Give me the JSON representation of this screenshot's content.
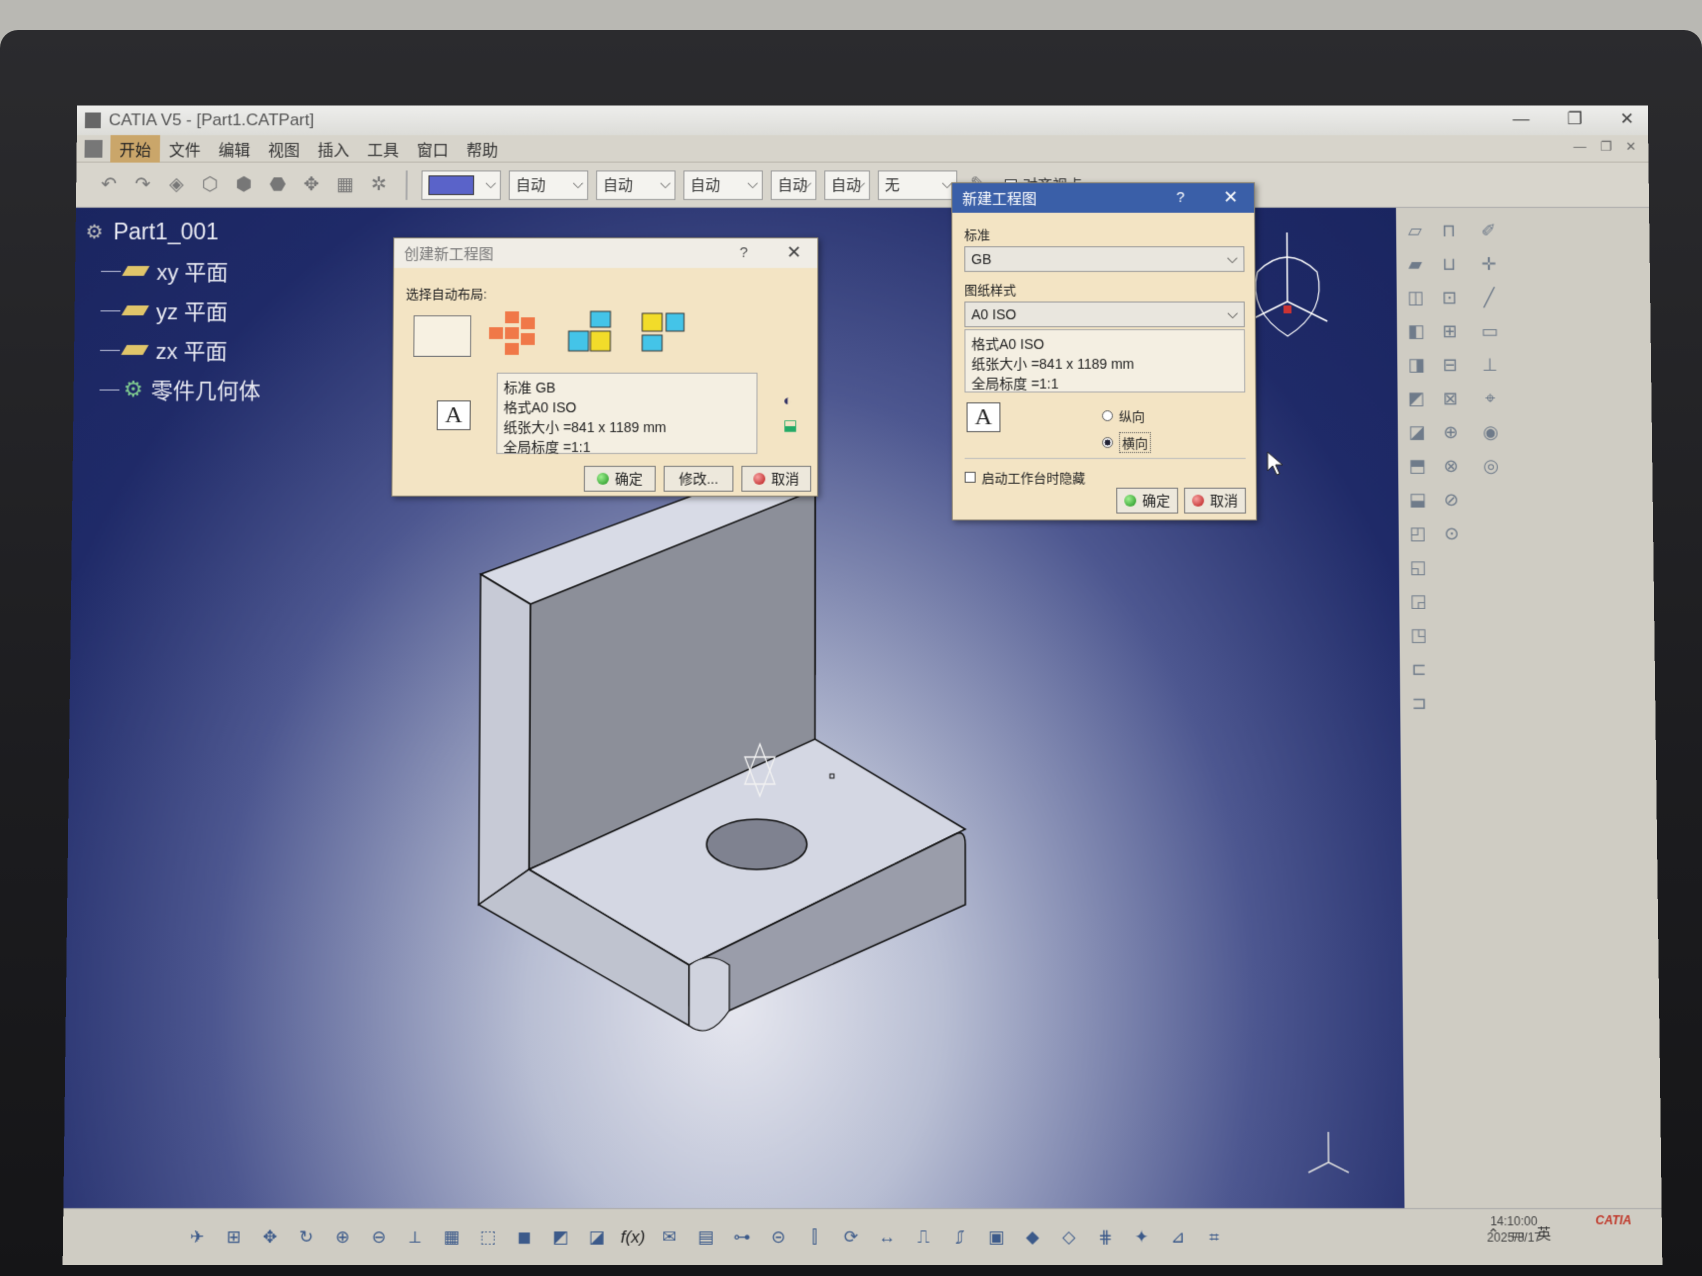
{
  "window": {
    "title": "CATIA V5 - [Part1.CATPart]",
    "min": "—",
    "restore": "❐",
    "close": "✕"
  },
  "menu": {
    "items": [
      {
        "label": "开始",
        "active": true
      },
      {
        "label": "文件"
      },
      {
        "label": "编辑"
      },
      {
        "label": "视图"
      },
      {
        "label": "插入"
      },
      {
        "label": "工具"
      },
      {
        "label": "窗口"
      },
      {
        "label": "帮助"
      }
    ]
  },
  "toolbar": {
    "color": "#5a63c9",
    "combos": [
      "自动",
      "自动",
      "自动",
      "自动",
      "自动",
      "无"
    ],
    "snap_label": "对齐视点"
  },
  "tree": {
    "root": "Part1_001",
    "items": [
      "xy 平面",
      "yz 平面",
      "zx 平面",
      "零件几何体"
    ]
  },
  "dialog_create": {
    "title": "创建新工程图",
    "help": "?",
    "close": "✕",
    "layout_label": "选择自动布局:",
    "info": [
      "标准 GB",
      "格式A0 ISO",
      "纸张大小 =841 x 1189 mm",
      "全局标度 =1:1"
    ],
    "ok": "确定",
    "modify": "修改...",
    "cancel": "取消"
  },
  "dialog_new": {
    "title": "新建工程图",
    "help": "?",
    "close": "✕",
    "standard_label": "标准",
    "standard_value": "GB",
    "sheet_style_label": "图纸样式",
    "sheet_style_value": "A0 ISO",
    "info": [
      "格式A0 ISO",
      "纸张大小 =841 x 1189 mm",
      "全局标度 =1:1"
    ],
    "portrait": "纵向",
    "landscape": "横向",
    "orientation_selected": "landscape",
    "hide_on_start": "启动工作台时隐藏",
    "ok": "确定",
    "cancel": "取消"
  },
  "taskbar": {
    "lang": "英",
    "time": "14:10:00",
    "date": "2025/8/17"
  },
  "brand": "CATIA"
}
